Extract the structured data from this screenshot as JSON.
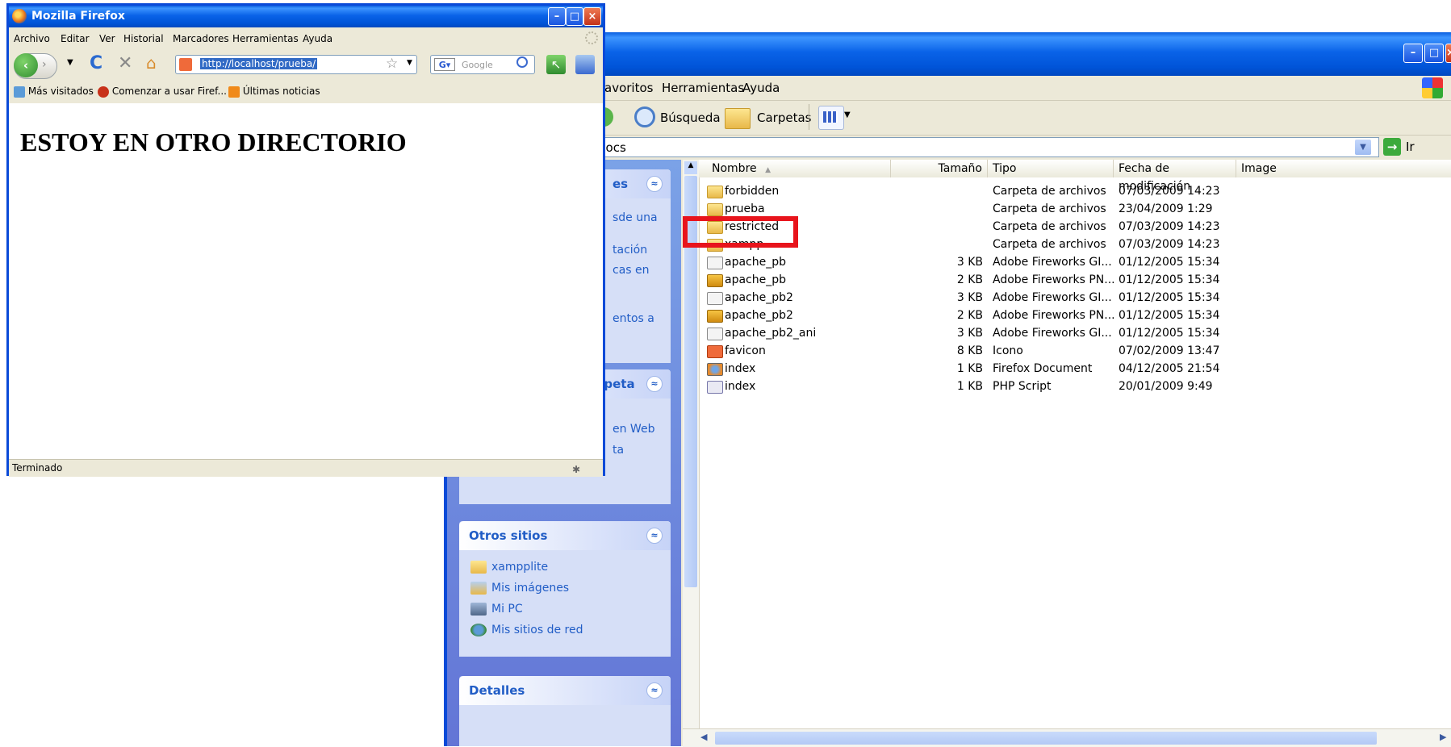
{
  "firefox": {
    "title": "Mozilla Firefox",
    "menu": [
      "Archivo",
      "Editar",
      "Ver",
      "Historial",
      "Marcadores",
      "Herramientas",
      "Ayuda"
    ],
    "url": "http://localhost/prueba/",
    "search_placeholder": "Google",
    "bookmarks": [
      "Más visitados",
      "Comenzar a usar Firef...",
      "Últimas noticias"
    ],
    "page_heading": "ESTOY EN OTRO DIRECTORIO",
    "status": "Terminado"
  },
  "explorer": {
    "menu": [
      "avoritos",
      "Herramientas",
      "Ayuda"
    ],
    "toolbar": {
      "search_label": "Búsqueda",
      "folders_label": "Carpetas"
    },
    "address_value": "docs",
    "go_label": "Ir",
    "taskpane": {
      "panel1_title": "es",
      "panel1_links": [
        "sde una",
        "tación",
        "cas en",
        "entos a"
      ],
      "panel2_title": "rpeta",
      "panel2_links": [
        "en Web",
        "ta"
      ],
      "other_sites_title": "Otros sitios",
      "other_sites": [
        "xampplite",
        "Mis imágenes",
        "Mi PC",
        "Mis sitios de red"
      ],
      "details_title": "Detalles"
    },
    "columns": {
      "name": "Nombre",
      "size": "Tamaño",
      "type": "Tipo",
      "date": "Fecha de modificación",
      "extra": "Image"
    },
    "files": [
      {
        "icon": "folder",
        "name": "forbidden",
        "size": "",
        "type": "Carpeta de archivos",
        "date": "07/03/2009 14:23"
      },
      {
        "icon": "folder",
        "name": "prueba",
        "size": "",
        "type": "Carpeta de archivos",
        "date": "23/04/2009 1:29"
      },
      {
        "icon": "folder",
        "name": "restricted",
        "size": "",
        "type": "Carpeta de archivos",
        "date": "07/03/2009 14:23"
      },
      {
        "icon": "folder",
        "name": "xampp",
        "size": "",
        "type": "Carpeta de archivos",
        "date": "07/03/2009 14:23"
      },
      {
        "icon": "gif",
        "name": "apache_pb",
        "size": "3 KB",
        "type": "Adobe Fireworks GI...",
        "date": "01/12/2005 15:34"
      },
      {
        "icon": "png",
        "name": "apache_pb",
        "size": "2 KB",
        "type": "Adobe Fireworks PN...",
        "date": "01/12/2005 15:34"
      },
      {
        "icon": "gif",
        "name": "apache_pb2",
        "size": "3 KB",
        "type": "Adobe Fireworks GI...",
        "date": "01/12/2005 15:34"
      },
      {
        "icon": "png",
        "name": "apache_pb2",
        "size": "2 KB",
        "type": "Adobe Fireworks PN...",
        "date": "01/12/2005 15:34"
      },
      {
        "icon": "gif",
        "name": "apache_pb2_ani",
        "size": "3 KB",
        "type": "Adobe Fireworks GI...",
        "date": "01/12/2005 15:34"
      },
      {
        "icon": "xicon",
        "name": "favicon",
        "size": "8 KB",
        "type": "Icono",
        "date": "07/02/2009 13:47"
      },
      {
        "icon": "ffdoc",
        "name": "index",
        "size": "1 KB",
        "type": "Firefox Document",
        "date": "04/12/2005 21:54"
      },
      {
        "icon": "php",
        "name": "index",
        "size": "1 KB",
        "type": "PHP Script",
        "date": "20/01/2009 9:49"
      }
    ],
    "highlight_color": "#e8141c"
  }
}
